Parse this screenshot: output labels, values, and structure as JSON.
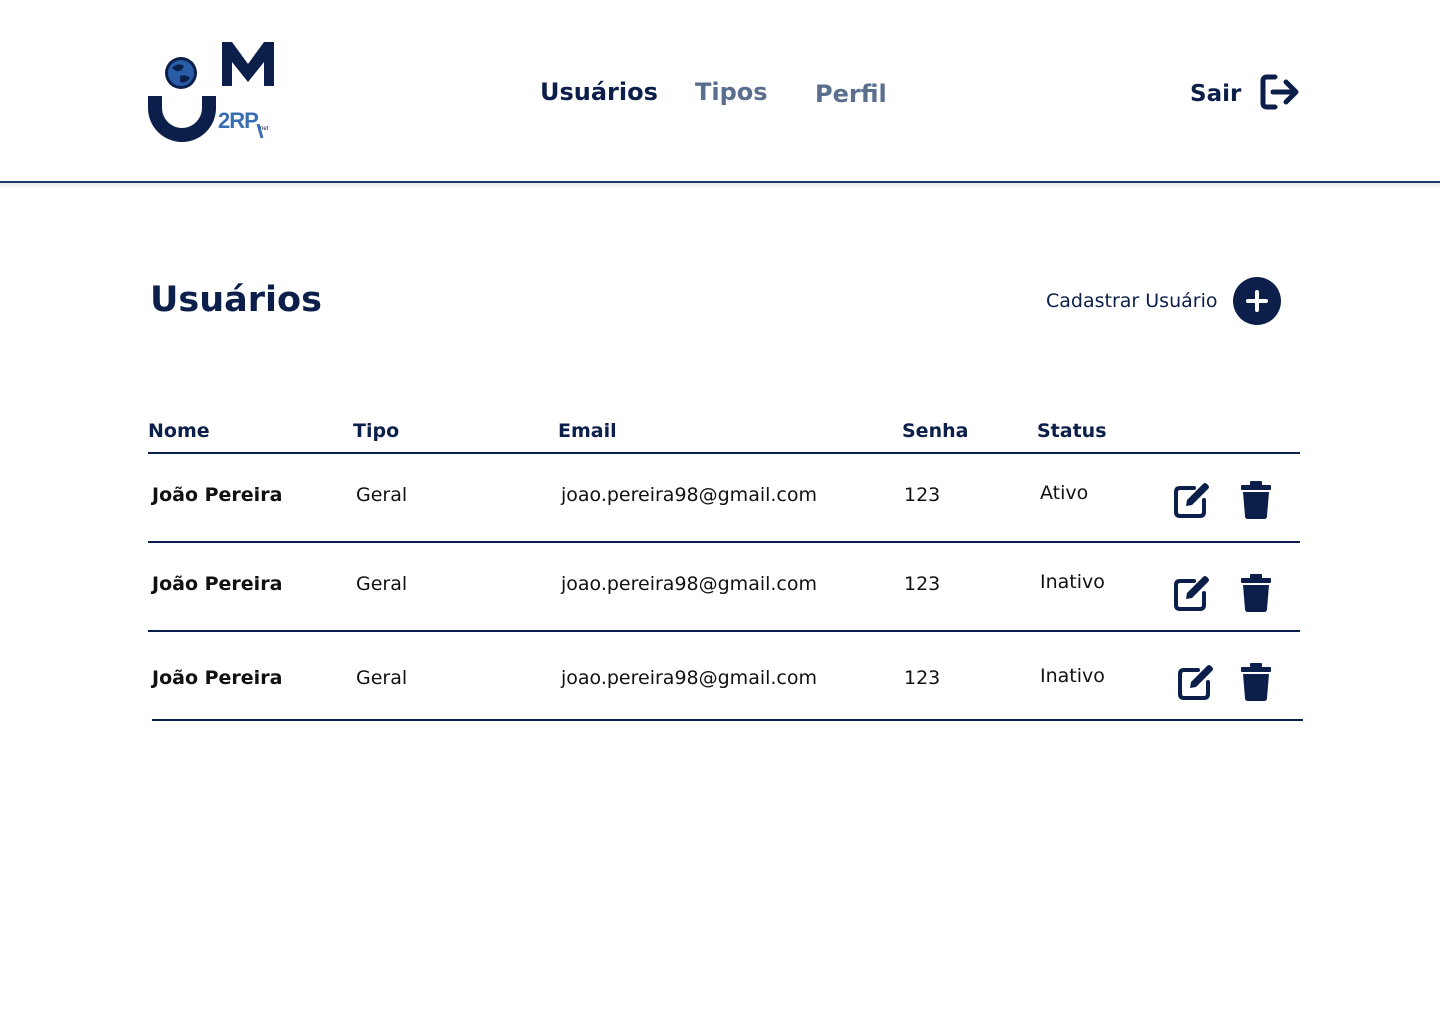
{
  "header": {
    "logo_alt": "JM 2RP net",
    "nav": [
      {
        "label": "Usuários",
        "active": true
      },
      {
        "label": "Tipos",
        "active": false
      },
      {
        "label": "Perfil",
        "active": false
      }
    ],
    "logout_label": "Sair",
    "logout_icon": "logout-icon"
  },
  "main": {
    "title": "Usuários",
    "add_user_label": "Cadastrar Usuário",
    "add_user_icon": "plus-icon"
  },
  "table": {
    "columns": [
      "Nome",
      "Tipo",
      "Email",
      "Senha",
      "Status"
    ],
    "rows": [
      {
        "nome": "João Pereira",
        "tipo": "Geral",
        "email": "joao.pereira98@gmail.com",
        "senha": "123",
        "status": "Ativo"
      },
      {
        "nome": "João Pereira",
        "tipo": "Geral",
        "email": "joao.pereira98@gmail.com",
        "senha": "123",
        "status": "Inativo"
      },
      {
        "nome": "João Pereira",
        "tipo": "Geral",
        "email": "joao.pereira98@gmail.com",
        "senha": "123",
        "status": "Inativo"
      }
    ],
    "row_actions": [
      "edit-icon",
      "trash-icon"
    ]
  },
  "colors": {
    "primary": "#0b1f4a",
    "muted_nav": "#5a6f8e",
    "logo_accent": "#3a6fb5"
  }
}
